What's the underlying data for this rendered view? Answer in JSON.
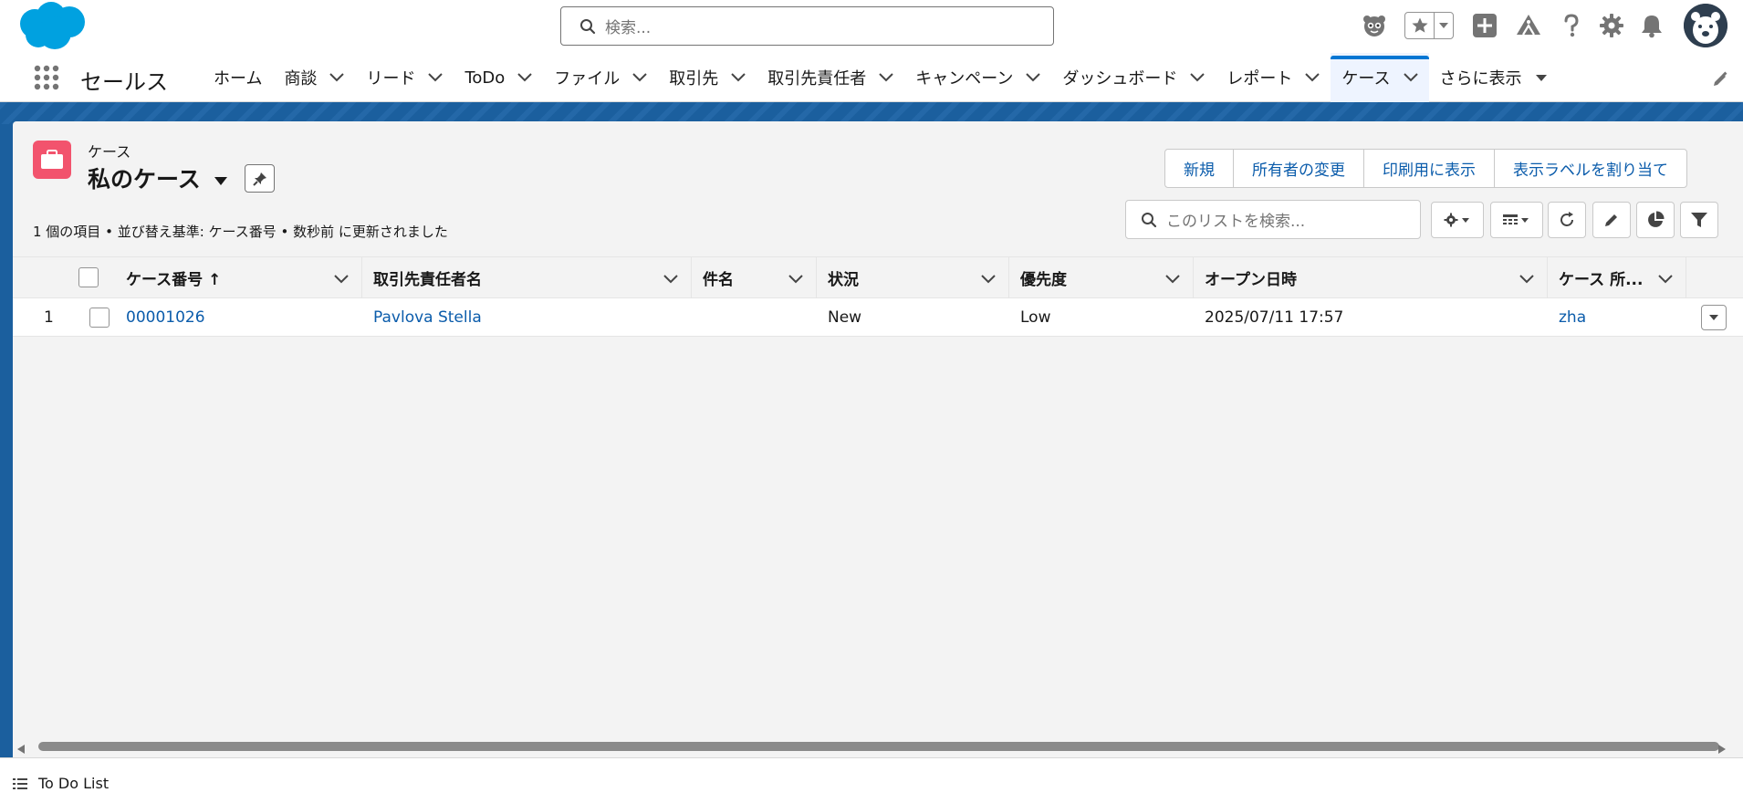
{
  "header": {
    "search_placeholder": "検索...",
    "icons": [
      "cloud-logo",
      "search-icon",
      "einstein-icon",
      "star-icon",
      "add-icon",
      "trailhead-icon",
      "help-icon",
      "gear-icon",
      "bell-icon",
      "avatar"
    ]
  },
  "nav": {
    "app_name": "セールス",
    "items": [
      {
        "label": "ホーム",
        "has_menu": false
      },
      {
        "label": "商談",
        "has_menu": true
      },
      {
        "label": "リード",
        "has_menu": true
      },
      {
        "label": "ToDo",
        "has_menu": true
      },
      {
        "label": "ファイル",
        "has_menu": true
      },
      {
        "label": "取引先",
        "has_menu": true
      },
      {
        "label": "取引先責任者",
        "has_menu": true
      },
      {
        "label": "キャンペーン",
        "has_menu": true
      },
      {
        "label": "ダッシュボード",
        "has_menu": true
      },
      {
        "label": "レポート",
        "has_menu": true
      },
      {
        "label": "ケース",
        "has_menu": true,
        "active": true
      },
      {
        "label": "さらに表示",
        "has_menu": true
      }
    ]
  },
  "list_view": {
    "object_label": "ケース",
    "title": "私のケース",
    "actions": [
      "新規",
      "所有者の変更",
      "印刷用に表示",
      "表示ラベルを割り当て"
    ],
    "meta": "1 個の項目 • 並び替え基準: ケース番号 • 数秒前 に更新されました",
    "search_placeholder": "このリストを検索..."
  },
  "table": {
    "columns": [
      "ケース番号 ↑",
      "取引先責任者名",
      "件名",
      "状況",
      "優先度",
      "オープン日時",
      "ケース 所..."
    ],
    "rows": [
      {
        "num": "1",
        "case_number": "00001026",
        "contact": "Pavlova Stella",
        "subject": "",
        "status": "New",
        "priority": "Low",
        "opened": "2025/07/11 17:57",
        "owner": "zha"
      }
    ]
  },
  "footer": {
    "utility_label": "To Do List"
  },
  "colors": {
    "brand_blue": "#0176d3",
    "link_blue": "#0b5cab",
    "case_icon": "#f2536d",
    "band_blue": "#1b5f9e"
  }
}
